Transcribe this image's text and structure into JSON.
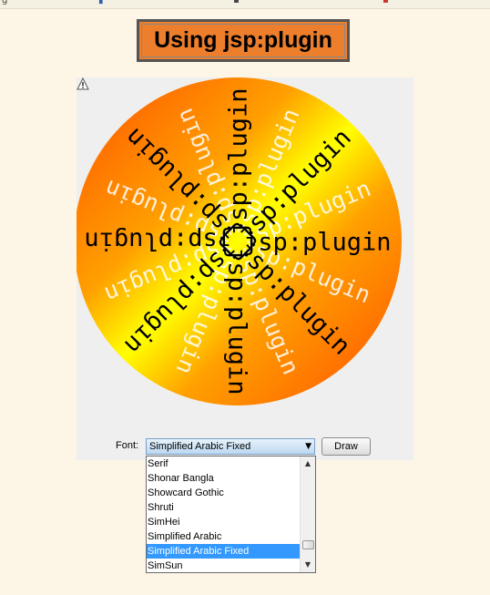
{
  "title": "Using jsp:plugin",
  "applet": {
    "word": "jsp:plugin",
    "font_label": "Font:",
    "selected_font": "Simplified Arabic Fixed",
    "draw_button": "Draw"
  },
  "font_list": {
    "items": [
      "Serif",
      "Shonar Bangla",
      "Showcard Gothic",
      "Shruti",
      "SimHei",
      "Simplified Arabic",
      "Simplified Arabic Fixed",
      "SimSun"
    ],
    "selected_index": 6
  },
  "colors": {
    "page_bg": "#fdf5e6",
    "title_bg": "#ec7e2c",
    "gradient_outer": "#ff5a00",
    "gradient_inner": "#ffff00",
    "selection": "#3399ff"
  },
  "icons": {
    "warning": "warning-icon",
    "dropdown": "chevron-down-icon"
  }
}
